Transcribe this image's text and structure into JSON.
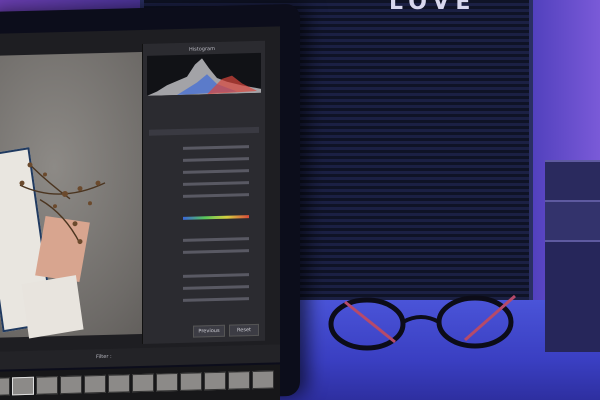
{
  "scene": {
    "letter_board_text": "LOVE"
  },
  "lightroom": {
    "panel_title": "Histogram",
    "buttons": {
      "previous": "Previous",
      "reset": "Reset"
    },
    "filmstrip_label": "Filter :",
    "thumbnail_count": 12
  },
  "colors": {
    "wall_purple": "#6a3fb0",
    "desk_blue": "#3a3fc2",
    "board_dark": "#0f1326",
    "screen_bg": "#1e1e22"
  }
}
